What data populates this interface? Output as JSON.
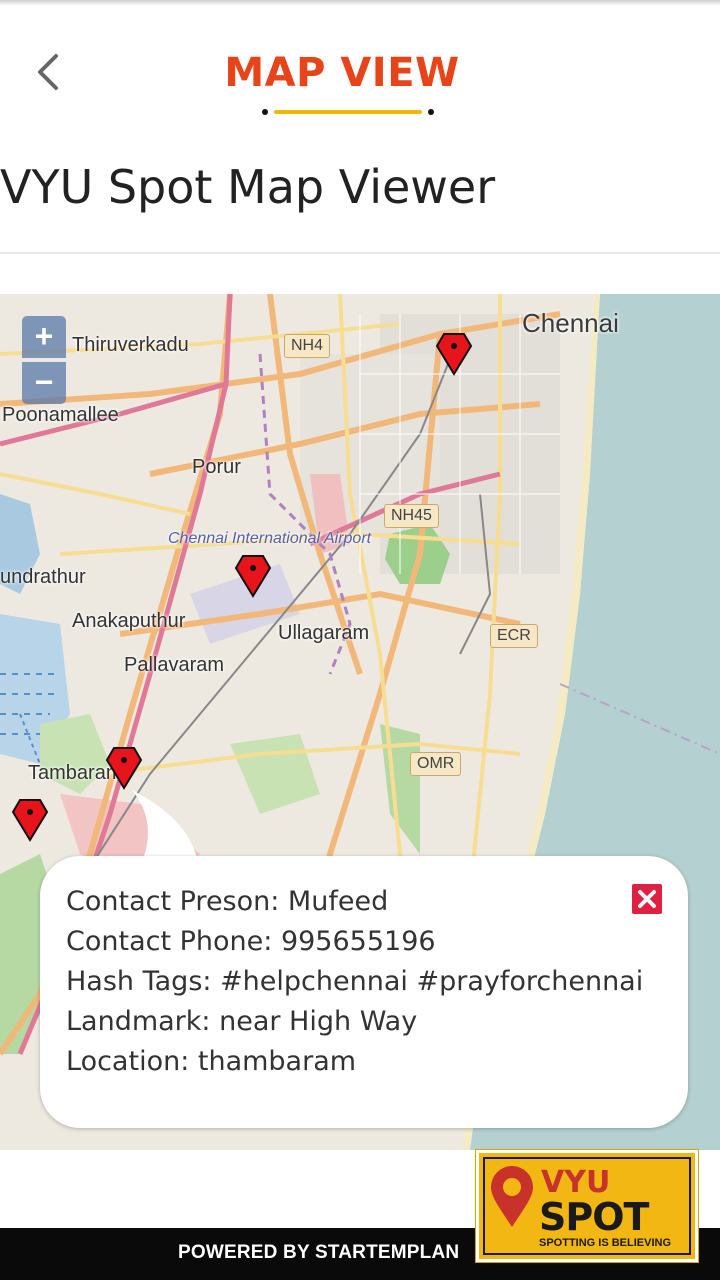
{
  "header": {
    "title": "MAP VIEW",
    "back_icon": "chevron-left-icon"
  },
  "page": {
    "heading": "VYU Spot Map Viewer"
  },
  "map": {
    "zoom_in_label": "+",
    "zoom_out_label": "−",
    "places": {
      "chennai": "Chennai",
      "thiruverkadu": "Thiruverkadu",
      "poonamallee": "Poonamallee",
      "porur": "Porur",
      "airport": "Chennai International Airport",
      "undrathur": "undrathur",
      "anakaputhur": "Anakaputhur",
      "ullagaram": "Ullagaram",
      "pallavaram": "Pallavaram",
      "tambaram": "Tambaram"
    },
    "roads": {
      "nh4": "NH4",
      "nh45": "NH45",
      "ecr": "ECR",
      "omr": "OMR"
    },
    "marker_icon": "map-pin-icon",
    "colors": {
      "water": "#b5d0d0",
      "marker": "#e8141b"
    }
  },
  "popup": {
    "contact_person": "Contact Preson: Mufeed",
    "contact_phone": "Contact Phone: 995655196",
    "hash_tags": "Hash Tags: #helpchennai #prayforchennai",
    "landmark": "Landmark: near High Way",
    "location": "Location: thambaram",
    "close_icon": "close-icon"
  },
  "footer": {
    "text": "POWERED BY STARTEMPLAN"
  },
  "logo": {
    "vyu": "VYU",
    "spot": "SPOT",
    "tagline": "SPOTTING IS BELIEVING"
  },
  "colors": {
    "title": "#e8441a",
    "underline": "#f2b705",
    "logo_bg": "#f3b714"
  }
}
